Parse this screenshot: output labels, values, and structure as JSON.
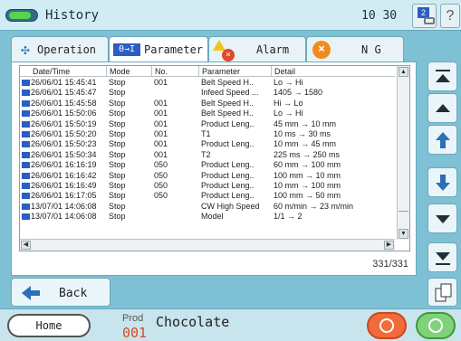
{
  "title": "History",
  "clock": "10 30",
  "user_badge": "2",
  "help_glyph": "?",
  "tabs": [
    {
      "label": "Operation",
      "icon": "operation-icon"
    },
    {
      "label": "Parameter",
      "icon_text": "0→I",
      "active": true
    },
    {
      "label": "Alarm",
      "icon": "alarm-icon"
    },
    {
      "label": "N G",
      "icon": "ng-icon"
    }
  ],
  "list": {
    "headers": [
      "Date/Time",
      "Mode",
      "No.",
      "Parameter",
      "Detail"
    ],
    "rows": [
      [
        "26/06/01 15:45:41",
        "Stop",
        "001",
        "Belt Speed H..",
        "Lo → Hi"
      ],
      [
        "26/06/01 15:45:47",
        "Stop",
        "",
        "Infeed Speed ...",
        "1405 → 1580"
      ],
      [
        "26/06/01 15:45:58",
        "Stop",
        "001",
        "Belt Speed H..",
        "Hi → Lo"
      ],
      [
        "26/06/01 15:50:06",
        "Stop",
        "001",
        "Belt Speed H..",
        "Lo → Hi"
      ],
      [
        "26/06/01 15:50:19",
        "Stop",
        "001",
        "Product Leng..",
        "45 mm → 10 mm"
      ],
      [
        "26/06/01 15:50:20",
        "Stop",
        "001",
        "T1",
        "10 ms → 30 ms"
      ],
      [
        "26/06/01 15:50:23",
        "Stop",
        "001",
        "Product Leng..",
        "10 mm → 45 mm"
      ],
      [
        "26/06/01 15:50:34",
        "Stop",
        "001",
        "T2",
        "225 ms → 250 ms"
      ],
      [
        "26/06/01 16:16:19",
        "Stop",
        "050",
        "Product Leng..",
        "60 mm → 100 mm"
      ],
      [
        "26/06/01 16:16:42",
        "Stop",
        "050",
        "Product Leng..",
        "100 mm → 10 mm"
      ],
      [
        "26/06/01 16:16:49",
        "Stop",
        "050",
        "Product Leng..",
        "10 mm → 100 mm"
      ],
      [
        "26/06/01 16:17:05",
        "Stop",
        "050",
        "Product Leng..",
        "100 mm → 50 mm"
      ],
      [
        "13/07/01 14:06:08",
        "Stop",
        "",
        "CW High Speed",
        "60 m/min → 23 m/min"
      ],
      [
        "13/07/01 14:06:08",
        "Stop",
        "",
        "Model",
        "1/1 → 2"
      ]
    ],
    "counter": "331/331"
  },
  "back_label": "Back",
  "footer": {
    "home_label": "Home",
    "prod_label": "Prod",
    "prod_no": "001",
    "prod_name": "Chocolate"
  },
  "colors": {
    "background": "#7ec0d4",
    "accent_blue": "#2a5ec4",
    "stop": "#f26b3a",
    "start": "#7fd27a"
  }
}
